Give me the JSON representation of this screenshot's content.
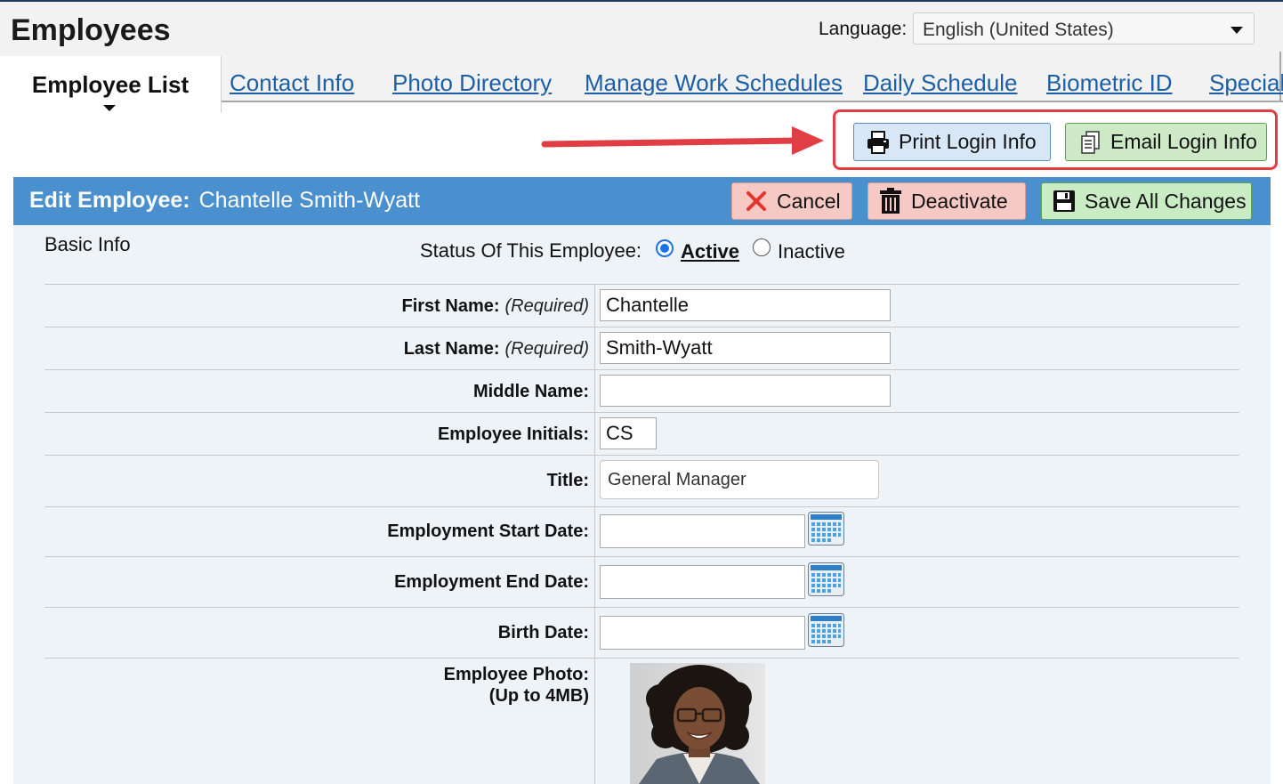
{
  "header": {
    "title": "Employees",
    "language_label": "Language:",
    "language_value": "English (United States)"
  },
  "tabs": {
    "active": "Employee List",
    "items": [
      "Contact Info",
      "Photo Directory",
      "Manage Work Schedules",
      "Daily Schedule",
      "Biometric ID",
      "Special"
    ]
  },
  "actions": {
    "print_login": "Print Login Info",
    "email_login": "Email Login Info"
  },
  "edit_bar": {
    "prefix": "Edit Employee:",
    "employee_name": "Chantelle Smith-Wyatt",
    "cancel": "Cancel",
    "deactivate": "Deactivate",
    "save": "Save All Changes"
  },
  "basic_info": {
    "section": "Basic Info",
    "status_label": "Status Of This Employee:",
    "status_active": "Active",
    "status_inactive": "Inactive",
    "selected_status": "Active"
  },
  "fields": {
    "first_name": {
      "label": "First Name:",
      "note": "(Required)",
      "value": "Chantelle"
    },
    "last_name": {
      "label": "Last Name:",
      "note": "(Required)",
      "value": "Smith-Wyatt"
    },
    "middle_name": {
      "label": "Middle Name:",
      "value": ""
    },
    "initials": {
      "label": "Employee Initials:",
      "value": "CS"
    },
    "title": {
      "label": "Title:",
      "value": "General Manager"
    },
    "start_date": {
      "label": "Employment Start Date:",
      "value": ""
    },
    "end_date": {
      "label": "Employment End Date:",
      "value": ""
    },
    "birth_date": {
      "label": "Birth Date:",
      "value": ""
    },
    "photo": {
      "label": "Employee Photo:",
      "note": "(Up to 4MB)"
    }
  },
  "colors": {
    "edit_bar": "#4a8fce",
    "link": "#1d5fa6",
    "highlight": "#e03e44",
    "cancel_bg": "#f6c9c5",
    "save_bg": "#c9ecc4",
    "print_bg": "#d7e7f6"
  },
  "icons": {
    "print": "printer-icon",
    "email": "document-copy-icon",
    "cancel": "x-icon",
    "deactivate": "trash-icon",
    "save": "floppy-disk-icon",
    "calendar": "calendar-icon"
  }
}
